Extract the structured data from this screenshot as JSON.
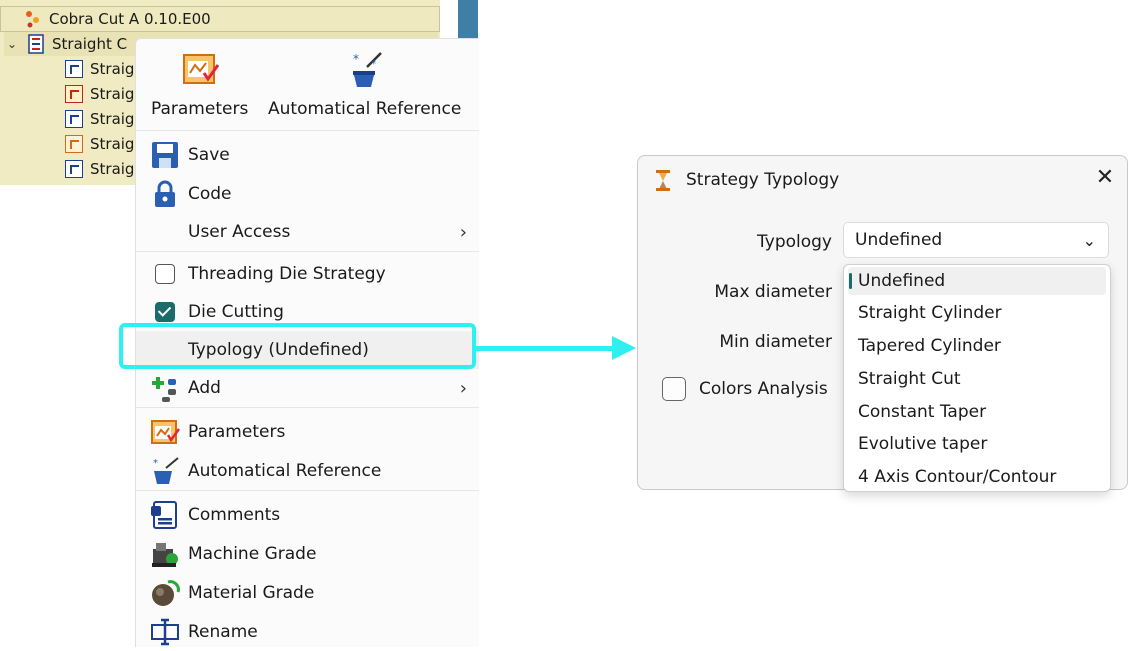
{
  "tree": {
    "root_label": "Cobra Cut A 0.10.E00",
    "node_label": "Straight C",
    "leaves": [
      {
        "label": "Straig",
        "color": "blue"
      },
      {
        "label": "Straig",
        "color": "red"
      },
      {
        "label": "Straig",
        "color": "blue"
      },
      {
        "label": "Straig",
        "color": "orange"
      },
      {
        "label": "Straig",
        "color": "blue"
      }
    ]
  },
  "menu": {
    "top_buttons": [
      {
        "label": "Parameters",
        "icon": "parameters-icon"
      },
      {
        "label": "Automatical Reference",
        "icon": "magic-wand-icon"
      }
    ],
    "items": {
      "save": "Save",
      "code": "Code",
      "user_access": "User Access",
      "threading": "Threading Die Strategy",
      "die_cutting": "Die Cutting",
      "typology": "Typology (Undefined)",
      "add": "Add",
      "parameters": "Parameters",
      "auto_ref": "Automatical Reference",
      "comments": "Comments",
      "machine_grade": "Machine Grade",
      "material_grade": "Material Grade",
      "rename": "Rename"
    },
    "threading_checked": false,
    "die_cutting_checked": true
  },
  "dialog": {
    "title": "Strategy Typology",
    "close_glyph": "✕",
    "typology_label": "Typology",
    "typology_value": "Undefined",
    "max_label": "Max diameter",
    "min_label": "Min diameter",
    "colors_label": "Colors Analysis",
    "colors_checked": false,
    "options": [
      "Undefined",
      "Straight Cylinder",
      "Tapered Cylinder",
      "Straight Cut",
      "Constant Taper",
      "Evolutive taper",
      "4 Axis Contour/Contour"
    ],
    "selected_option": "Undefined"
  },
  "colors": {
    "accent_cyan": "#2ef0f0",
    "tree_bg": "#f0ebc2",
    "check_accent": "#1a6b6a"
  }
}
